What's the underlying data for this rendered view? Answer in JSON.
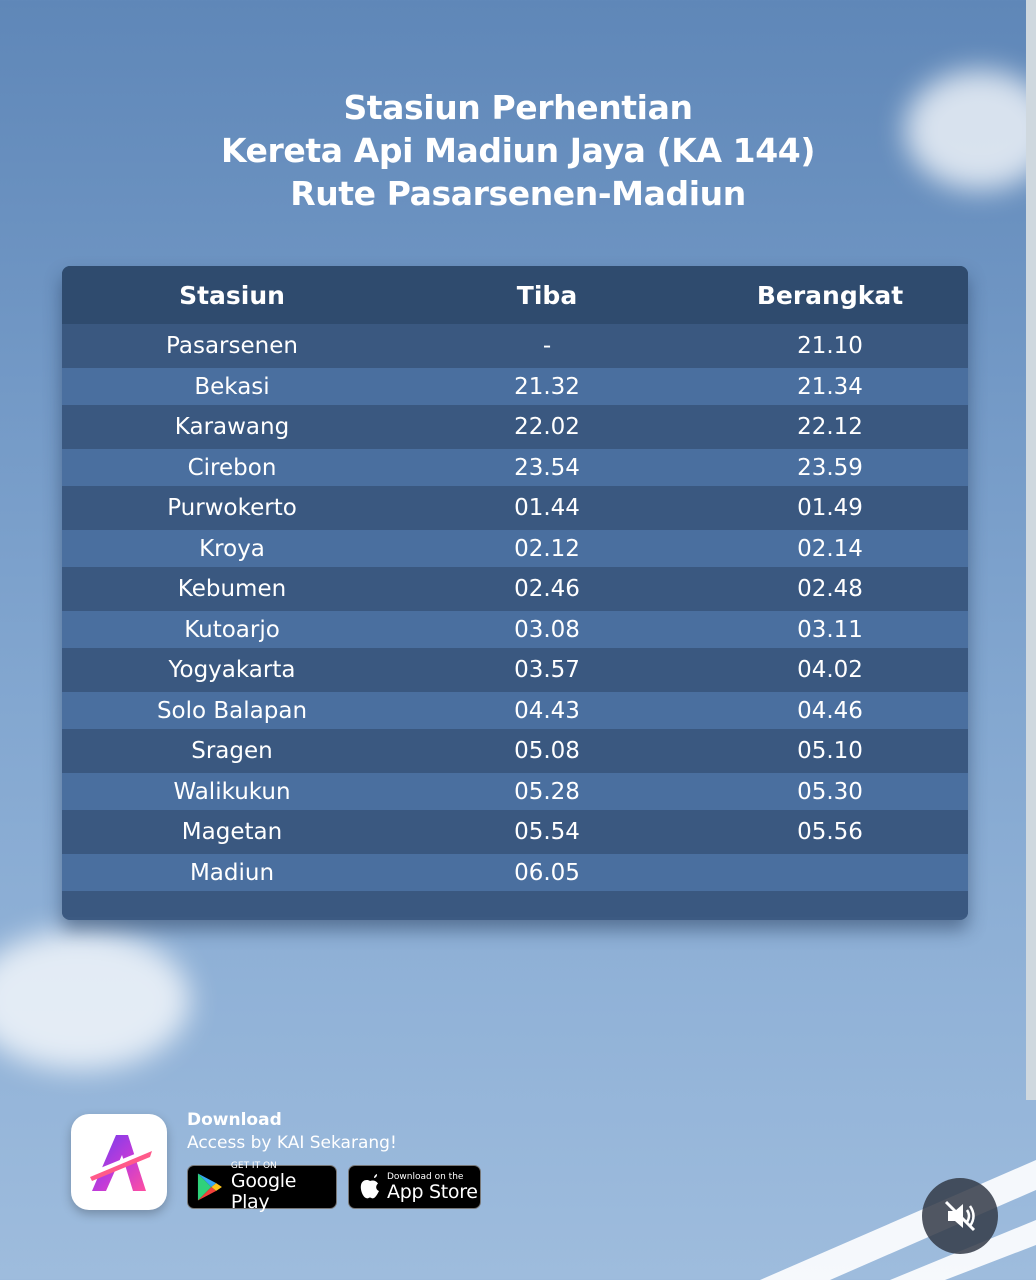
{
  "title": {
    "line1": "Stasiun Perhentian",
    "line2": "Kereta Api Madiun Jaya (KA 144)",
    "line3": "Rute Pasarsenen-Madiun"
  },
  "table": {
    "headers": [
      "Stasiun",
      "Tiba",
      "Berangkat"
    ],
    "rows": [
      [
        "Pasarsenen",
        "-",
        "21.10"
      ],
      [
        "Bekasi",
        "21.32",
        "21.34"
      ],
      [
        "Karawang",
        "22.02",
        "22.12"
      ],
      [
        "Cirebon",
        "23.54",
        "23.59"
      ],
      [
        "Purwokerto",
        "01.44",
        "01.49"
      ],
      [
        "Kroya",
        "02.12",
        "02.14"
      ],
      [
        "Kebumen",
        "02.46",
        "02.48"
      ],
      [
        "Kutoarjo",
        "03.08",
        "03.11"
      ],
      [
        "Yogyakarta",
        "03.57",
        "04.02"
      ],
      [
        "Solo Balapan",
        "04.43",
        "04.46"
      ],
      [
        "Sragen",
        "05.08",
        "05.10"
      ],
      [
        "Walikukun",
        "05.28",
        "05.30"
      ],
      [
        "Magetan",
        "05.54",
        "05.56"
      ],
      [
        "Madiun",
        "06.05",
        ""
      ]
    ]
  },
  "promo": {
    "download_title": "Download",
    "download_subtitle": "Access by KAI Sekarang!",
    "google_play": {
      "small": "GET IT ON",
      "big": "Google Play"
    },
    "app_store": {
      "small": "Download on the",
      "big": "App Store"
    }
  },
  "icons": {
    "app": "access-by-kai-logo-icon",
    "google_play": "google-play-icon",
    "apple": "apple-icon",
    "mute": "speaker-muted-icon"
  },
  "colors": {
    "header_row": "#2f4b6e",
    "row_dark": "#3a5880",
    "row_light": "#4a6f9f"
  }
}
